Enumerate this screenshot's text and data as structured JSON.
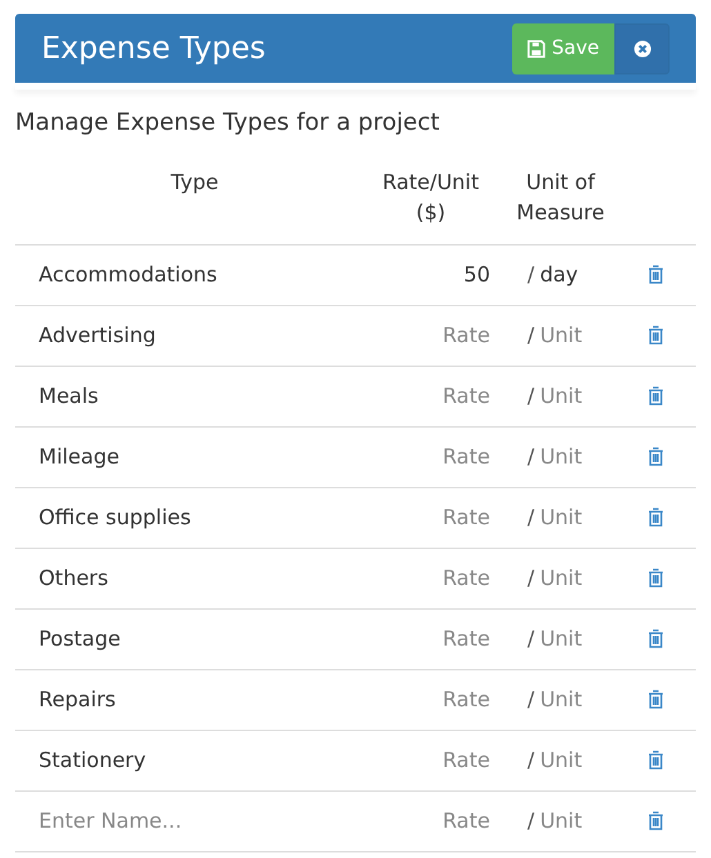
{
  "header": {
    "title": "Expense Types",
    "save_button": "Save"
  },
  "subtitle": "Manage Expense Types for a project",
  "columns": [
    "Type",
    "Rate/Unit ($)",
    "Unit of Measure"
  ],
  "rows": [
    {
      "name": {
        "value": "Accommodations"
      },
      "rate": {
        "value": "50"
      },
      "separator": "/",
      "unit": {
        "value": "day"
      }
    },
    {
      "name": {
        "value": "Advertising"
      },
      "rate": {
        "placeholder": "Rate"
      },
      "separator": "/",
      "unit": {
        "placeholder": "Unit"
      }
    },
    {
      "name": {
        "value": "Meals"
      },
      "rate": {
        "placeholder": "Rate"
      },
      "separator": "/",
      "unit": {
        "placeholder": "Unit"
      }
    },
    {
      "name": {
        "value": "Mileage"
      },
      "rate": {
        "placeholder": "Rate"
      },
      "separator": "/",
      "unit": {
        "placeholder": "Unit"
      }
    },
    {
      "name": {
        "value": "Office supplies"
      },
      "rate": {
        "placeholder": "Rate"
      },
      "separator": "/",
      "unit": {
        "placeholder": "Unit"
      }
    },
    {
      "name": {
        "value": "Others"
      },
      "rate": {
        "placeholder": "Rate"
      },
      "separator": "/",
      "unit": {
        "placeholder": "Unit"
      }
    },
    {
      "name": {
        "value": "Postage"
      },
      "rate": {
        "placeholder": "Rate"
      },
      "separator": "/",
      "unit": {
        "placeholder": "Unit"
      }
    },
    {
      "name": {
        "value": "Repairs"
      },
      "rate": {
        "placeholder": "Rate"
      },
      "separator": "/",
      "unit": {
        "placeholder": "Unit"
      }
    },
    {
      "name": {
        "value": "Stationery"
      },
      "rate": {
        "placeholder": "Rate"
      },
      "separator": "/",
      "unit": {
        "placeholder": "Unit"
      }
    },
    {
      "name": {
        "placeholder": "Enter Name..."
      },
      "rate": {
        "placeholder": "Rate"
      },
      "separator": "/",
      "unit": {
        "placeholder": "Unit"
      }
    }
  ]
}
